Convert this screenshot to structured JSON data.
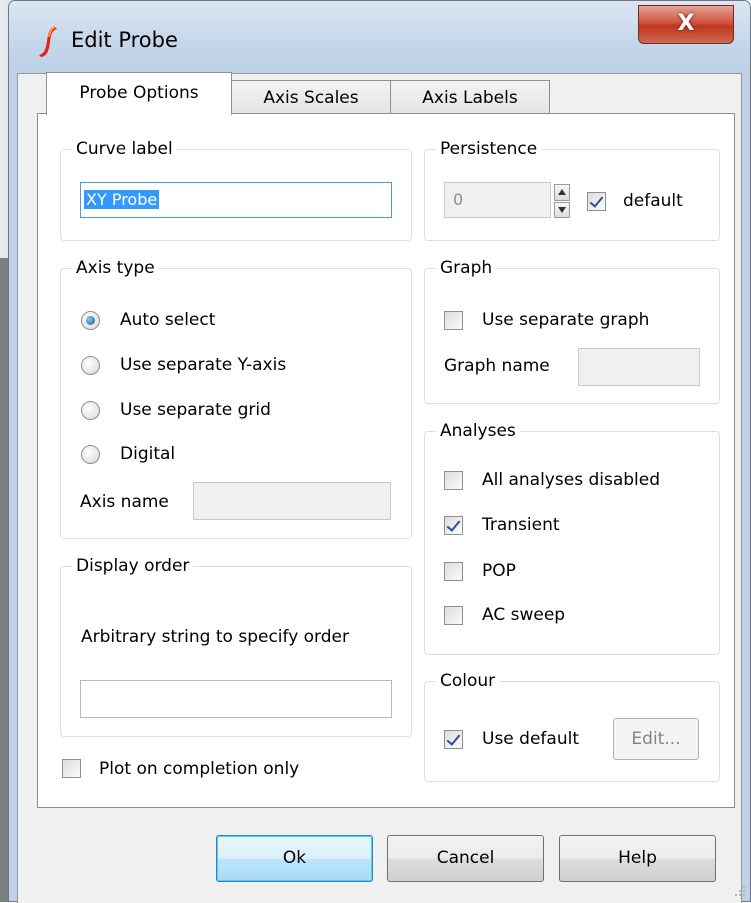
{
  "window": {
    "title": "Edit Probe",
    "close_glyph": "X"
  },
  "tabs": [
    {
      "label": "Probe Options"
    },
    {
      "label": "Axis Scales"
    },
    {
      "label": "Axis Labels"
    }
  ],
  "curve_label": {
    "title": "Curve label",
    "value": "XY Probe"
  },
  "axis_type": {
    "title": "Axis type",
    "options": [
      "Auto select",
      "Use separate Y-axis",
      "Use separate grid",
      "Digital"
    ],
    "selected": "Auto select",
    "axis_name_label": "Axis name",
    "axis_name_value": ""
  },
  "display_order": {
    "title": "Display order",
    "description": "Arbitrary string to specify order",
    "value": ""
  },
  "plot_on_completion": {
    "label": "Plot on completion only",
    "checked": false
  },
  "persistence": {
    "title": "Persistence",
    "value": "0",
    "default_label": "default",
    "default_checked": true
  },
  "graph": {
    "title": "Graph",
    "separate_label": "Use separate graph",
    "separate_checked": false,
    "name_label": "Graph name",
    "name_value": ""
  },
  "analyses": {
    "title": "Analyses",
    "items": [
      {
        "label": "All analyses disabled",
        "checked": false
      },
      {
        "label": "Transient",
        "checked": true
      },
      {
        "label": "POP",
        "checked": false
      },
      {
        "label": "AC sweep",
        "checked": false
      }
    ]
  },
  "colour": {
    "title": "Colour",
    "use_default_label": "Use default",
    "use_default_checked": true,
    "edit_label": "Edit..."
  },
  "buttons": {
    "ok": "Ok",
    "cancel": "Cancel",
    "help": "Help"
  },
  "colors": {
    "title_bar": "#c4d6ea",
    "close_button": "#c9432d",
    "focus_border": "#5596d8",
    "selection": "#3399ff",
    "check_mark": "#2e4f8e"
  }
}
